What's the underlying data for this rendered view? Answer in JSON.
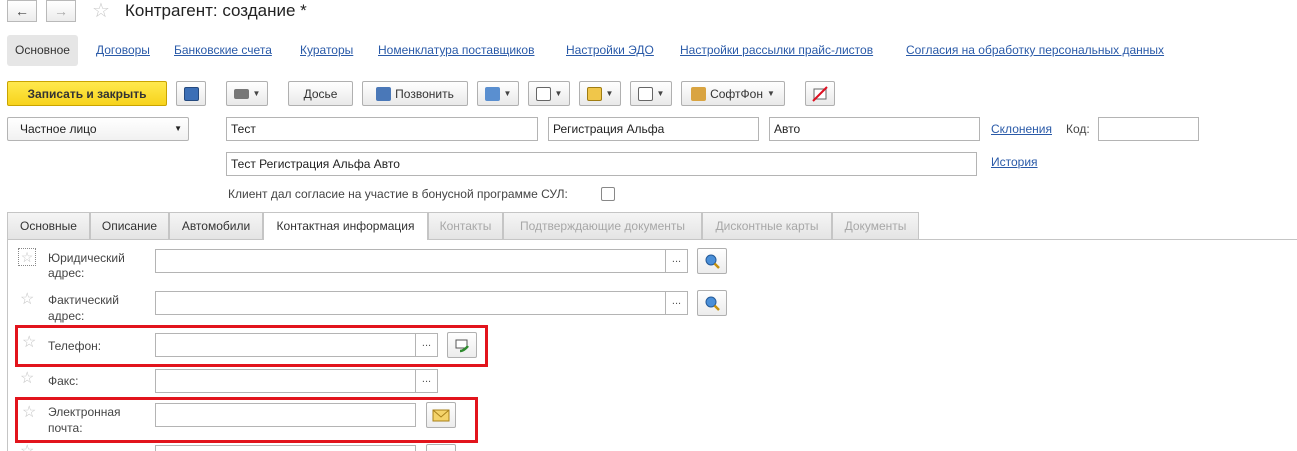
{
  "window": {
    "title": "Контрагент: создание *",
    "back_icon": "←",
    "forward_icon": "→",
    "favorite_icon": "☆"
  },
  "sections": {
    "active": "Основное",
    "links": [
      "Договоры",
      "Банковские счета",
      "Кураторы",
      "Номенклатура поставщиков",
      "Настройки ЭДО",
      "Настройки рассылки прайс-листов",
      "Согласия на обработку персональных данных"
    ]
  },
  "toolbar": {
    "save_close": "Записать и закрыть",
    "dossier": "Досье",
    "call": "Позвонить",
    "softphone": "СофтФон"
  },
  "form": {
    "kind": "Частное лицо",
    "last_name": "Тест",
    "first_name": "Регистрация Альфа",
    "middle_name": "Авто",
    "declensions": "Склонения",
    "code_label": "Код:",
    "code_value": "",
    "full_name": "Тест Регистрация Альфа Авто",
    "history": "История",
    "bonus_consent_label": "Клиент дал согласие на участие в бонусной программе СУЛ:",
    "bonus_consent_checked": false
  },
  "tabs": [
    {
      "label": "Основные",
      "state": "normal"
    },
    {
      "label": "Описание",
      "state": "normal"
    },
    {
      "label": "Автомобили",
      "state": "normal"
    },
    {
      "label": "Контактная информация",
      "state": "active"
    },
    {
      "label": "Контакты",
      "state": "disabled"
    },
    {
      "label": "Подтверждающие документы",
      "state": "disabled"
    },
    {
      "label": "Дисконтные карты",
      "state": "disabled"
    },
    {
      "label": "Документы",
      "state": "disabled"
    }
  ],
  "contacts": {
    "legal_address": {
      "label_1": "Юридический",
      "label_2": "адрес:",
      "value": ""
    },
    "actual_address": {
      "label_1": "Фактический",
      "label_2": "адрес:",
      "value": ""
    },
    "phone": {
      "label": "Телефон:",
      "value": ""
    },
    "fax": {
      "label": "Факс:",
      "value": ""
    },
    "email": {
      "label_1": "Электронная",
      "label_2": "почта:",
      "value": ""
    },
    "dots": "..."
  },
  "colors": {
    "accent_yellow": "#f7d31c",
    "link_blue": "#2a5aa8",
    "highlight_red": "#e2141c"
  }
}
